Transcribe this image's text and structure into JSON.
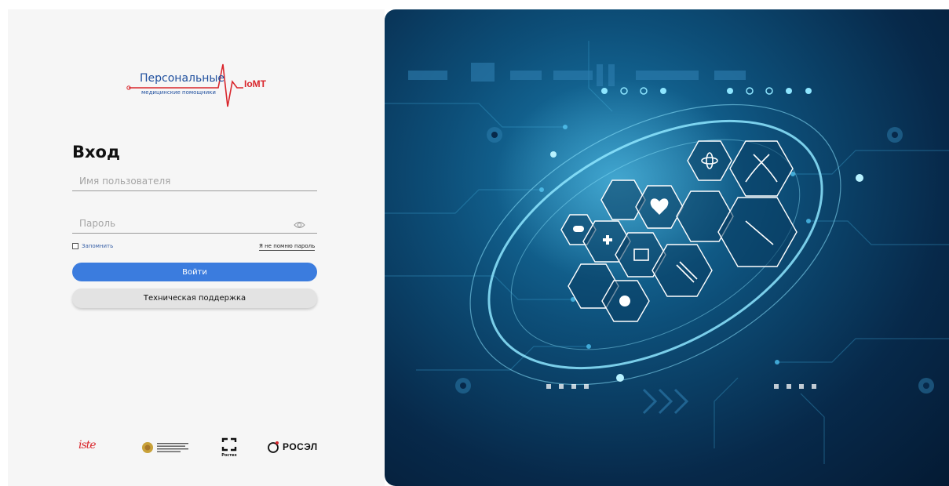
{
  "logo": {
    "line1": "Персональные",
    "line2": "медицинские помощники",
    "brand": "IoMT"
  },
  "login": {
    "title": "Вход",
    "username_placeholder": "Имя пользователя",
    "password_placeholder": "Пароль",
    "remember_label": "Запомнить",
    "forgot_label": "Я не помню пароль",
    "login_button": "Войти",
    "support_button": "Техническая поддержка"
  },
  "partners": {
    "rostec_label": "Ростех",
    "rosel_label": "РОСЭЛ"
  },
  "colors": {
    "primary": "#3b7cde",
    "brand_red": "#d9262c",
    "brand_blue": "#1f4f9e"
  },
  "icons": {
    "password_toggle": "eye-icon"
  }
}
